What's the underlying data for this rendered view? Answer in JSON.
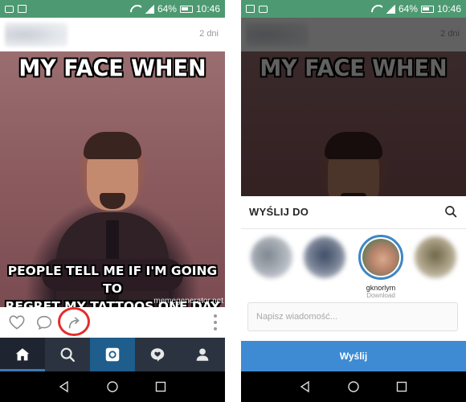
{
  "status_bar": {
    "battery": "64%",
    "time": "10:46"
  },
  "post": {
    "time_ago": "2 dni",
    "meme_top": "MY FACE WHEN",
    "meme_bottom_line1": "PEOPLE TELL ME IF I'M GOING TO",
    "meme_bottom_line2": "REGRET MY TATTOOS ONE DAY",
    "watermark": "memegenerator.net"
  },
  "icons": {
    "like": "heart-icon",
    "comment": "comment-icon",
    "share": "share-arrow-icon",
    "more": "more-vertical-icon",
    "tabs": [
      "home-icon",
      "search-icon",
      "camera-icon",
      "activity-icon",
      "profile-icon"
    ],
    "nav": [
      "back-icon",
      "home-circle-icon",
      "recents-icon"
    ]
  },
  "share_sheet": {
    "title": "WYŚLIJ DO",
    "recipient_name": "gknorlym",
    "recipient_sub": "Download",
    "message_placeholder": "Napisz wiadomość...",
    "send_label": "Wyślij"
  },
  "colors": {
    "status_bar": "#4d9a72",
    "tab_bar": "#2b3340",
    "camera_tab": "#1e5d8c",
    "send_button": "#3e8bd4",
    "highlight_ring": "#e42d2d",
    "selected_ring": "#3e86c6"
  }
}
